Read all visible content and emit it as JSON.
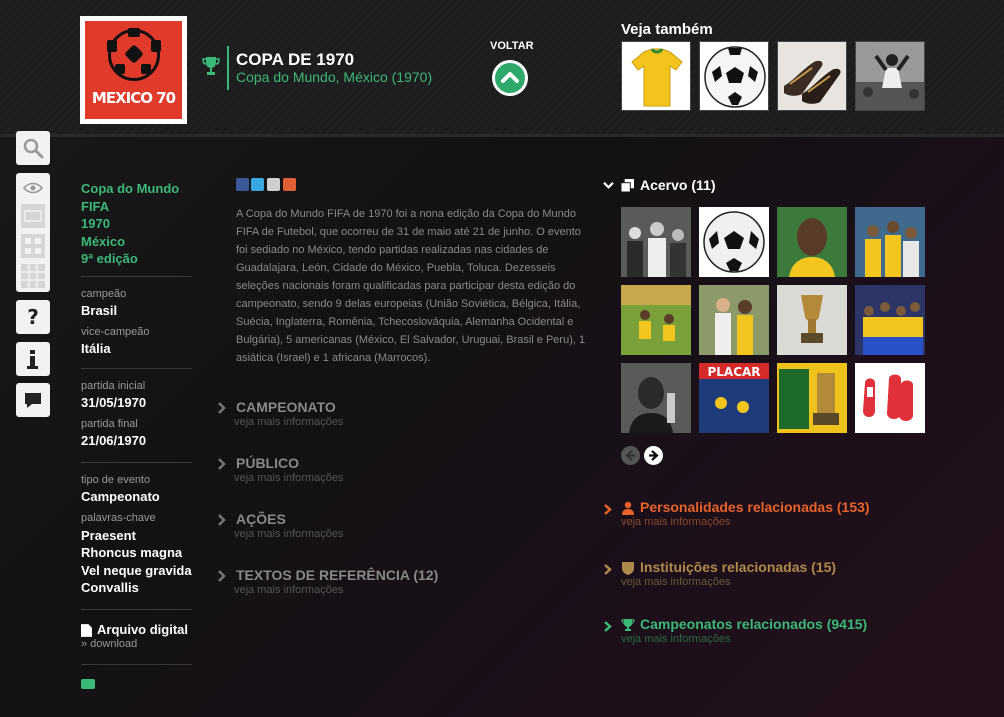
{
  "header": {
    "logo_text": "MEXICO 70",
    "title": "COPA DE 1970",
    "subtitle": "Copa do Mundo, México (1970)",
    "back_label": "VOLTAR",
    "see_also_title": "Veja também"
  },
  "see_also": [
    {
      "icon": "yellow-jersey"
    },
    {
      "icon": "adidas-ball"
    },
    {
      "icon": "football-boots"
    },
    {
      "icon": "player-celebration-photo"
    }
  ],
  "sidebar_tools": [
    "search-icon",
    "eye-icon",
    "help-icon",
    "info-icon",
    "comment-icon"
  ],
  "info": {
    "competition": "Copa do Mundo FIFA",
    "year": "1970",
    "country": "México",
    "edition": "9ª edição",
    "champion_label": "campeão",
    "champion": "Brasil",
    "runner_up_label": "vice-campeão",
    "runner_up": "Itália",
    "first_match_label": "partida inicial",
    "first_match": "31/05/1970",
    "final_match_label": "partida final",
    "final_match": "21/06/1970",
    "event_type_label": "tipo de evento",
    "event_type": "Campeonato",
    "keywords_label": "palavras-chave",
    "keywords": [
      "Praesent",
      "Rhoncus magna",
      "Vel neque gravida",
      "Convallis"
    ],
    "archive_title": "Arquivo digital",
    "archive_sub": "» download"
  },
  "description": "A Copa do Mundo FIFA de 1970 foi a nona edição da Copa do Mundo FIFA de Futebol, que ocorreu de 31 de maio até 21 de junho. O evento foi sediado no México, tendo partidas realizadas nas cidades de Guadalajara, León, Cidade do México, Puebla, Toluca. Dezesseis seleções nacionais foram qualificadas para participar desta edição do campeonato, sendo 9 delas europeias (União Soviética, Bélgica, Itália, Suécia, Inglaterra, Romênia, Tchecoslováquia, Alemanha Ocidental e Bulgária), 5 americanas (México, El Salvador, Uruguai, Brasil e Peru), 1 asiática (Israel) e 1 africana (Marrocos).",
  "sections": [
    {
      "title": "CAMPEONATO",
      "sub": "veja mais informações"
    },
    {
      "title": "PÚBLICO",
      "sub": "veja mais informações"
    },
    {
      "title": "AÇÕES",
      "sub": "veja mais informações"
    },
    {
      "title": "TEXTOS DE REFERÊNCIA (12)",
      "sub": "veja mais informações"
    }
  ],
  "acervo": {
    "title": "Acervo (11)",
    "thumbs": [
      "crowd-photo",
      "telstar-ball",
      "player-portrait",
      "team-photo",
      "match-photo",
      "players-photo",
      "jules-rimet-trophy",
      "team-celebration",
      "pele-photo",
      "placar-magazine",
      "o-caneco-e-nosso-cover",
      "goalkeeper-gloves"
    ]
  },
  "related": [
    {
      "title": "Personalidades relacionadas (153)",
      "sub": "veja mais informações",
      "color": "#e8622a",
      "icon": "person-icon"
    },
    {
      "title": "Instituições relacionadas (15)",
      "sub": "veja mais informações",
      "color": "#b08a4a",
      "icon": "shield-icon"
    },
    {
      "title": "Campeonatos relacionados (9415)",
      "sub": "veja mais informações",
      "color": "#3cb879",
      "icon": "trophy-icon"
    }
  ],
  "colors": {
    "accent": "#3cb879",
    "orange": "#e8622a",
    "gold": "#b08a4a"
  }
}
